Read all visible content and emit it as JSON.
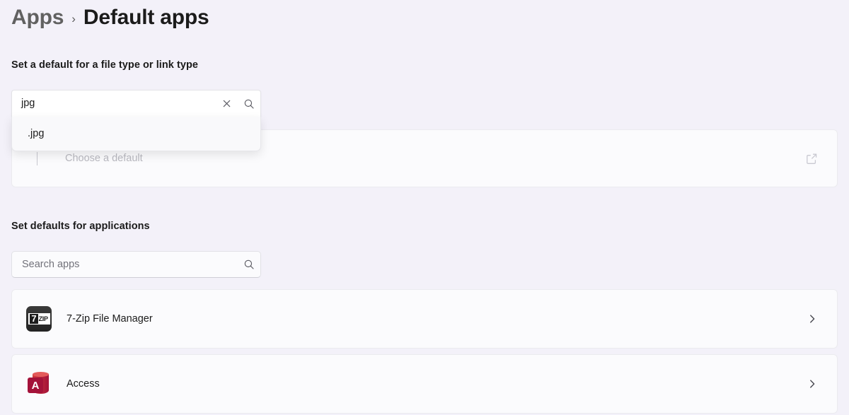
{
  "breadcrumb": {
    "parent": "Apps",
    "separator": "›",
    "current": "Default apps"
  },
  "sections": {
    "filetype_heading": "Set a default for a file type or link type",
    "applications_heading": "Set defaults for applications"
  },
  "filetype_search": {
    "value": "jpg",
    "clear_icon": "close-icon",
    "search_icon": "search-icon",
    "suggestions": [
      {
        "label": ".jpg"
      }
    ]
  },
  "default_card": {
    "label": "Choose a default",
    "external_link_icon": "external-link-icon"
  },
  "apps_search": {
    "placeholder": "Search apps",
    "value": "",
    "search_icon": "search-icon"
  },
  "apps_list": [
    {
      "name": "7-Zip File Manager",
      "icon": "seven-zip-icon",
      "chevron": "chevron-right-icon"
    },
    {
      "name": "Access",
      "icon": "access-icon",
      "chevron": "chevron-right-icon"
    }
  ],
  "icon_text": {
    "seven": "7",
    "zip": "ZIP",
    "access_letter": "A"
  },
  "colors": {
    "page_background": "#f3f1f9",
    "card_background": "#fbfbfd",
    "focus_underline": "#1e1e1e",
    "access_red": "#a4123a",
    "seven_zip_dark": "#2e2e2e"
  }
}
